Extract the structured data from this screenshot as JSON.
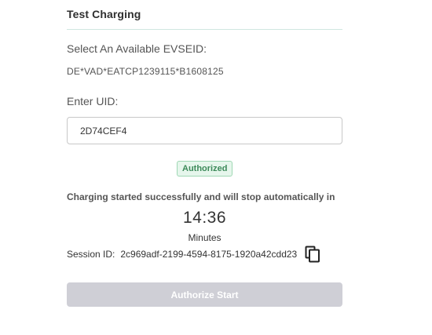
{
  "section": {
    "title": "Test Charging"
  },
  "evse": {
    "label": "Select An Available EVSEID:",
    "value": "DE*VAD*EATCP1239115*B1608125"
  },
  "uid": {
    "label": "Enter UID:",
    "value": "2D74CEF4"
  },
  "status": {
    "badge": "Authorized",
    "badge_color": "#3d8a5a",
    "message": "Charging started successfully and will stop automatically in",
    "timer": "14:36",
    "timer_unit": "Minutes"
  },
  "session": {
    "label": "Session ID:",
    "id": "2c969adf-2199-4594-8175-1920a42cdd23",
    "copy_icon": "copy-icon"
  },
  "actions": {
    "authorize_label": "Authorize Start",
    "authorize_disabled": true
  }
}
